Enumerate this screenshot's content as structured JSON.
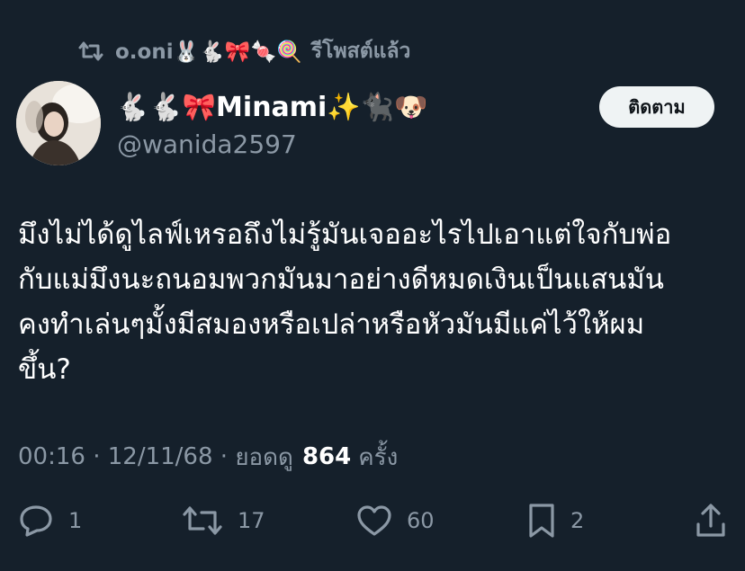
{
  "repost": {
    "user": "o.oni🐰🐇🎀🍬🍭",
    "label": "รีโพสต์แล้ว"
  },
  "author": {
    "display_name": "🐇🐇🎀Minami✨🐈‍⬛🐶",
    "handle": "@wanida2597"
  },
  "follow_button": "ติดตาม",
  "tweet": {
    "lines": [
      "มึงไม่ได้ดูไลฟ์เหรอถึงไม่รู้มันเจออะไรไปเอาแต่ใจกับพ่อ",
      "กับแม่มึงนะถนอมพวกมันมาอย่างดีหมดเงินเป็นแสนมัน",
      "คงทำเล่นๆมั้งมีสมองหรือเปล่าหรือหัวมันมีแค่ไว้ให้ผม",
      "ขึ้น?"
    ]
  },
  "meta": {
    "time": "00:16",
    "date": "12/11/68",
    "views_label": "ยอดดู",
    "views_count": "864",
    "views_unit": "ครั้ง"
  },
  "actions": {
    "replies": "1",
    "reposts": "17",
    "likes": "60",
    "bookmarks": "2"
  },
  "icons": {
    "repost": "repost-icon",
    "reply": "reply-icon",
    "like": "heart-icon",
    "bookmark": "bookmark-icon",
    "share": "share-icon"
  },
  "colors": {
    "background": "#15202b",
    "secondary_text": "#8b98a5",
    "follow_button_bg": "#eff3f4"
  }
}
